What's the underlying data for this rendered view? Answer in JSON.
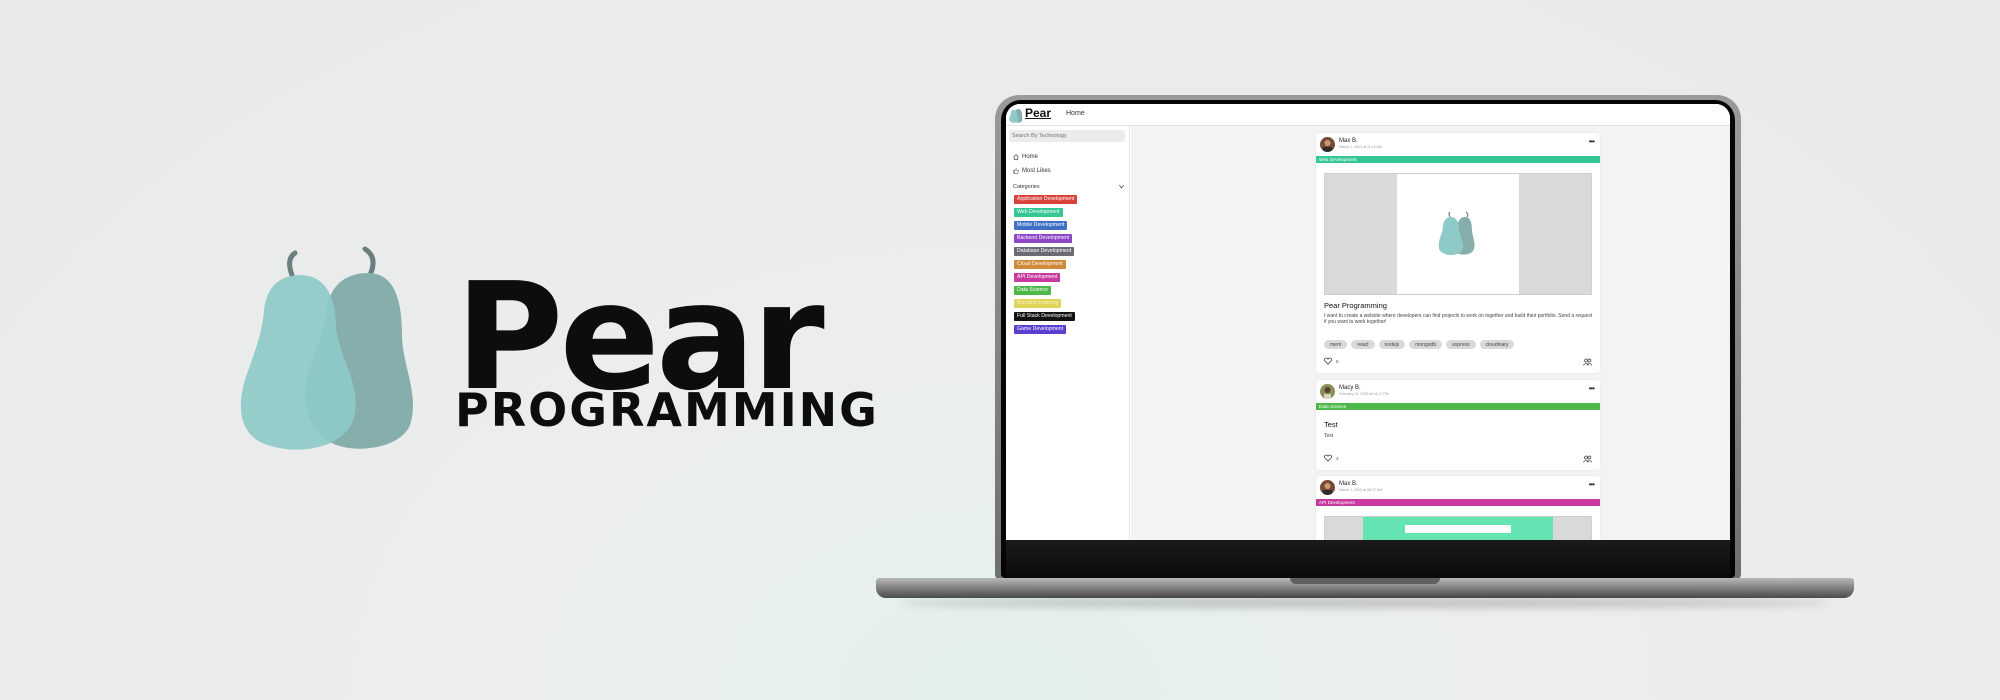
{
  "brand": {
    "title": "Pear",
    "subtitle": "PROGRAMMING"
  },
  "colors": {
    "pear_front": "#8ecac8",
    "pear_back": "#86aeac",
    "accent": "#35c792"
  },
  "app": {
    "name": "Pear",
    "nav": {
      "home": "Home"
    },
    "sidebar": {
      "search_placeholder": "Search By Technology",
      "links": [
        {
          "label": "Home",
          "icon": "home-icon"
        },
        {
          "label": "Most Likes",
          "icon": "thumbs-up-icon"
        }
      ],
      "categories_label": "Categories",
      "categories": [
        {
          "label": "Application Development",
          "color": "#d9413b"
        },
        {
          "label": "Web Development",
          "color": "#35c792"
        },
        {
          "label": "Mobile Development",
          "color": "#3f6fc4"
        },
        {
          "label": "Backend Development",
          "color": "#8e47c6"
        },
        {
          "label": "Database Development",
          "color": "#6b6b78"
        },
        {
          "label": "Cloud Development",
          "color": "#d18a3a"
        },
        {
          "label": "API Development",
          "color": "#c93aa0"
        },
        {
          "label": "Data Science",
          "color": "#4cb84a"
        },
        {
          "label": "Machine Learning",
          "color": "#e2d35a"
        },
        {
          "label": "Full Stack Development",
          "color": "#121212"
        },
        {
          "label": "Game Development",
          "color": "#5a3fd0"
        }
      ]
    },
    "posts": [
      {
        "author": "Max B.",
        "timestamp": "March 1, 2023 at 11:10 AM",
        "category": "Web Development",
        "category_color": "#35c792",
        "title": "Pear Programming",
        "description": "I want to create a website where developers can find projects to work on together and build their portfolio. Send a request if you want to work together!",
        "tags": [
          "mern",
          "react",
          "nodejs",
          "mongodb",
          "express",
          "cloudinary"
        ],
        "likes": "5"
      },
      {
        "author": "Macy B.",
        "timestamp": "February 14, 2023 at 04:17 PM",
        "category": "Data Science",
        "category_color": "#4cb84a",
        "title": "Test",
        "description": "Test",
        "likes": "2"
      },
      {
        "author": "Max B.",
        "timestamp": "March 1, 2023 at 06:37 AM",
        "category": "API Development",
        "category_color": "#c93aa0"
      }
    ]
  }
}
